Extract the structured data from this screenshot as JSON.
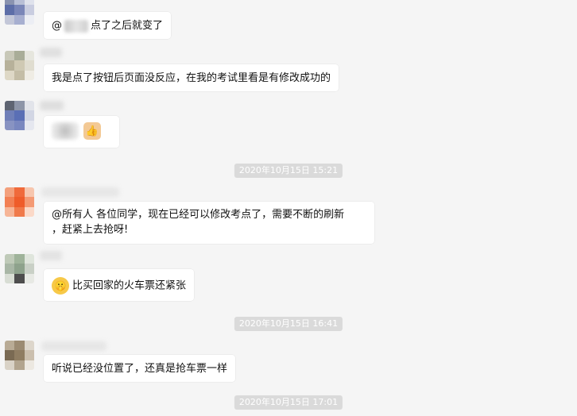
{
  "messages": [
    {
      "id": "m1",
      "text_before": "@",
      "text_after": "点了之后就变了"
    },
    {
      "id": "m2",
      "text": "我是点了按钮后页面没反应，在我的考试里看是有修改成功的"
    },
    {
      "id": "m3",
      "emoji_icon": "thumbs-up-icon"
    },
    {
      "id": "ts1",
      "timestamp": "2020年10月15日 15:21"
    },
    {
      "id": "m4",
      "line1": "@所有人 各位同学，现在已经可以修改考点了，需要不断的刷新",
      "line2": "，赶紧上去抢呀!"
    },
    {
      "id": "m5",
      "emoji_icon": "shushing-face-icon",
      "text": "比买回家的火车票还紧张"
    },
    {
      "id": "ts2",
      "timestamp": "2020年10月15日 16:41"
    },
    {
      "id": "m6",
      "text": "听说已经没位置了，还真是抢车票一样"
    },
    {
      "id": "ts3",
      "timestamp": "2020年10月15日 17:01"
    }
  ],
  "colors": {
    "chat_bg": "#f5f5f5",
    "bubble_bg": "#ffffff",
    "timestamp_bg": "#dadada"
  }
}
